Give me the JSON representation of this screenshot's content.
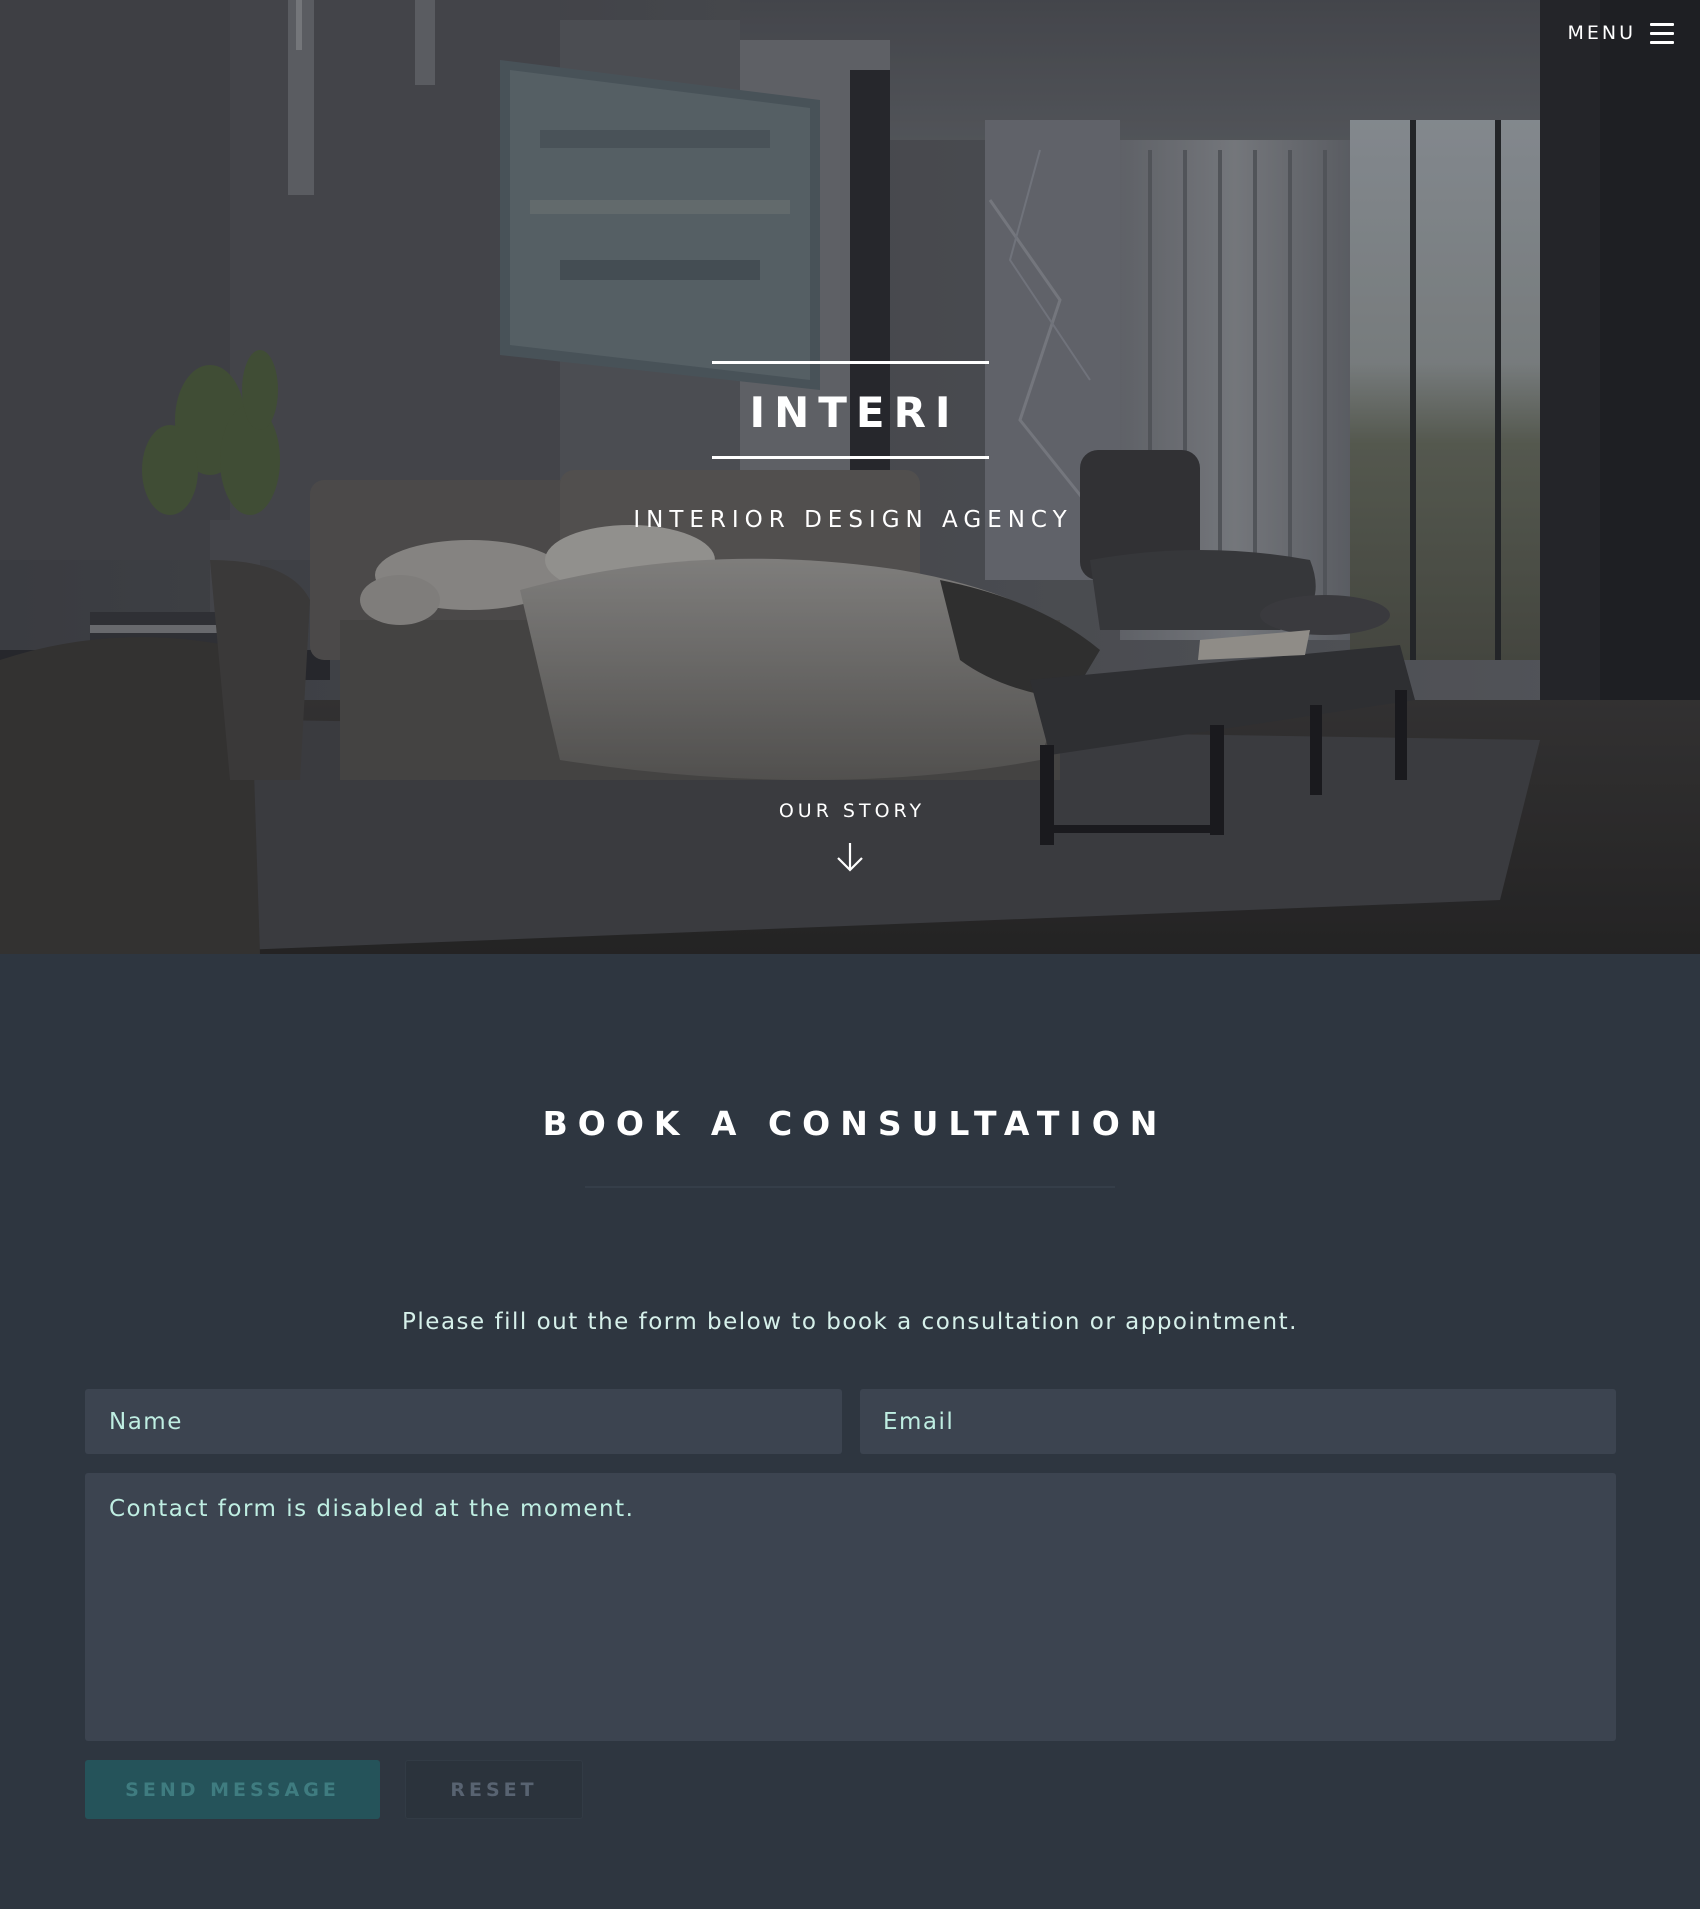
{
  "header": {
    "menu_label": "MENU"
  },
  "hero": {
    "title": "INTERI",
    "subtitle": "INTERIOR DESIGN AGENCY",
    "scroll_label": "OUR STORY"
  },
  "contact": {
    "title": "BOOK A CONSULTATION",
    "intro": "Please fill out the form below to book a consultation or appointment.",
    "name_placeholder": "Name",
    "email_placeholder": "Email",
    "message_placeholder": "Contact form is disabled at the moment.",
    "send_label": "SEND MESSAGE",
    "reset_label": "RESET"
  },
  "colors": {
    "page_background": "#2e3640",
    "field_background": "#3c4450",
    "field_text": "#bfeee2",
    "send_button": "#25535a"
  },
  "icons": {
    "menu": "hamburger-icon",
    "scroll": "arrow-down-icon"
  }
}
